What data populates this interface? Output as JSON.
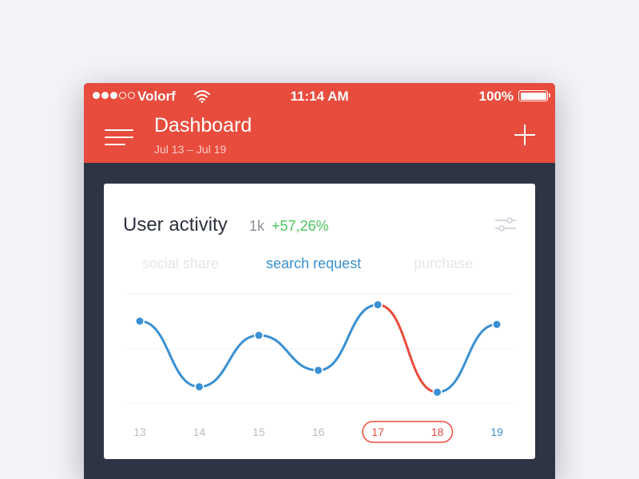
{
  "status": {
    "carrier": "Volorf",
    "time": "11:14 AM",
    "battery": "100%",
    "signal_bars": 5,
    "signal_filled": 3
  },
  "header": {
    "title": "Dashboard",
    "subtitle": "Jul 13 – Jul 19"
  },
  "card": {
    "title": "User activity",
    "count": "1k",
    "change": "+57,26%",
    "tabs": [
      {
        "label": "social share",
        "active": false
      },
      {
        "label": "search request",
        "active": true
      },
      {
        "label": "purchase",
        "active": false
      }
    ]
  },
  "colors": {
    "header": "#e84c3d",
    "background": "#2f3445",
    "line": "#3a90d2",
    "highlight": "#e84c3d",
    "positive": "#4cc45e"
  },
  "icons": {
    "menu": "hamburger-icon",
    "add": "plus-icon",
    "settings": "sliders-icon",
    "wifi": "wifi-icon",
    "battery": "battery-icon"
  },
  "chart_data": {
    "type": "line",
    "categories": [
      "13",
      "14",
      "15",
      "16",
      "17",
      "18",
      "19"
    ],
    "series": [
      {
        "name": "search request",
        "values": [
          75,
          15,
          62,
          30,
          90,
          10,
          72
        ]
      }
    ],
    "highlight_range": [
      "17",
      "18"
    ],
    "active_category": "19",
    "ylim": [
      0,
      100
    ],
    "grid": true
  }
}
